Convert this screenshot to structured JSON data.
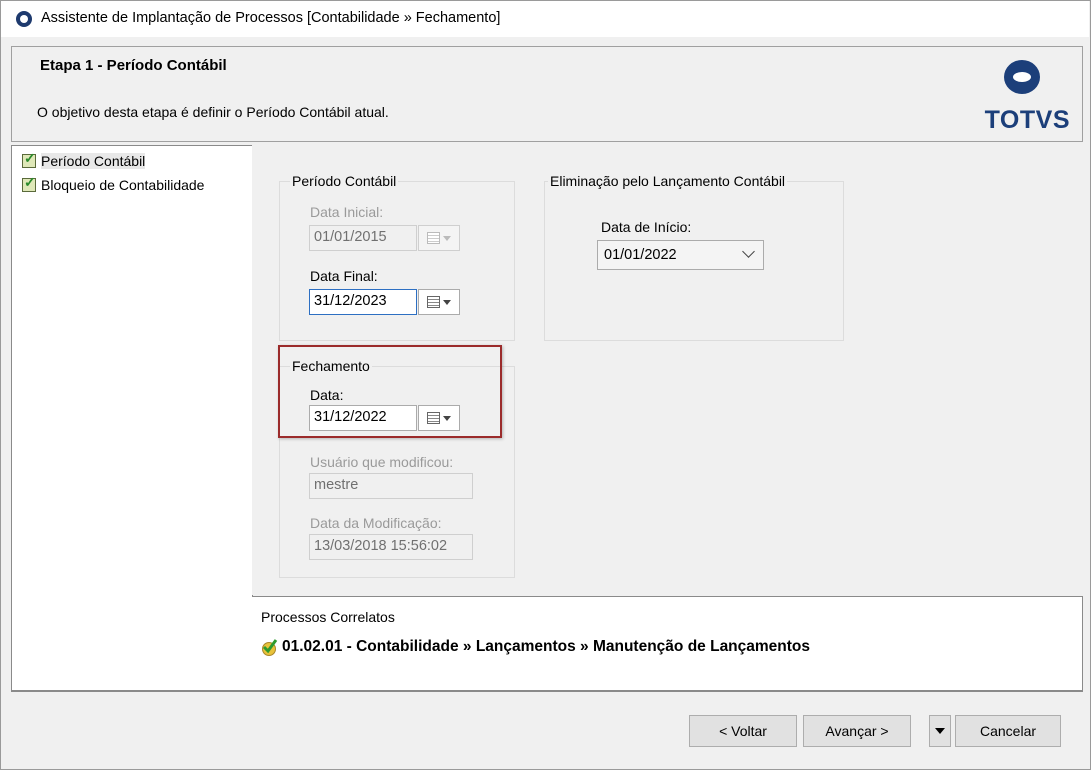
{
  "window": {
    "title": "Assistente de Implantação de Processos [Contabilidade » Fechamento]"
  },
  "header": {
    "step_title": "Etapa 1 - Período Contábil",
    "description": "O objetivo desta etapa é definir o Período Contábil atual.",
    "logo_text": "TOTVS"
  },
  "sidebar": {
    "items": [
      {
        "label": "Período Contábil",
        "selected": true
      },
      {
        "label": "Bloqueio de Contabilidade",
        "selected": false
      }
    ]
  },
  "periodo": {
    "group_label": "Período Contábil",
    "data_inicial_label": "Data Inicial:",
    "data_inicial_value": "01/01/2015",
    "data_final_label": "Data Final:",
    "data_final_value": "31/12/2023"
  },
  "eliminacao": {
    "group_label": "Eliminação pelo Lançamento Contábil",
    "data_inicio_label": "Data de Início:",
    "data_inicio_value": "01/01/2022"
  },
  "fechamento": {
    "group_label": "Fechamento",
    "data_label": "Data:",
    "data_value": "31/12/2022",
    "usuario_label": "Usuário que modificou:",
    "usuario_value": "mestre",
    "data_modificacao_label": "Data da Modificação:",
    "data_modificacao_value": "13/03/2018 15:56:02"
  },
  "related": {
    "title": "Processos Correlatos",
    "item": "01.02.01 - Contabilidade » Lançamentos » Manutenção de Lançamentos"
  },
  "buttons": {
    "back": "< Voltar",
    "next": "Avançar >",
    "cancel": "Cancelar"
  },
  "colors": {
    "highlight_border": "#9b2b2b",
    "brand": "#1c3f7a",
    "focus_border": "#2d6fc2"
  }
}
